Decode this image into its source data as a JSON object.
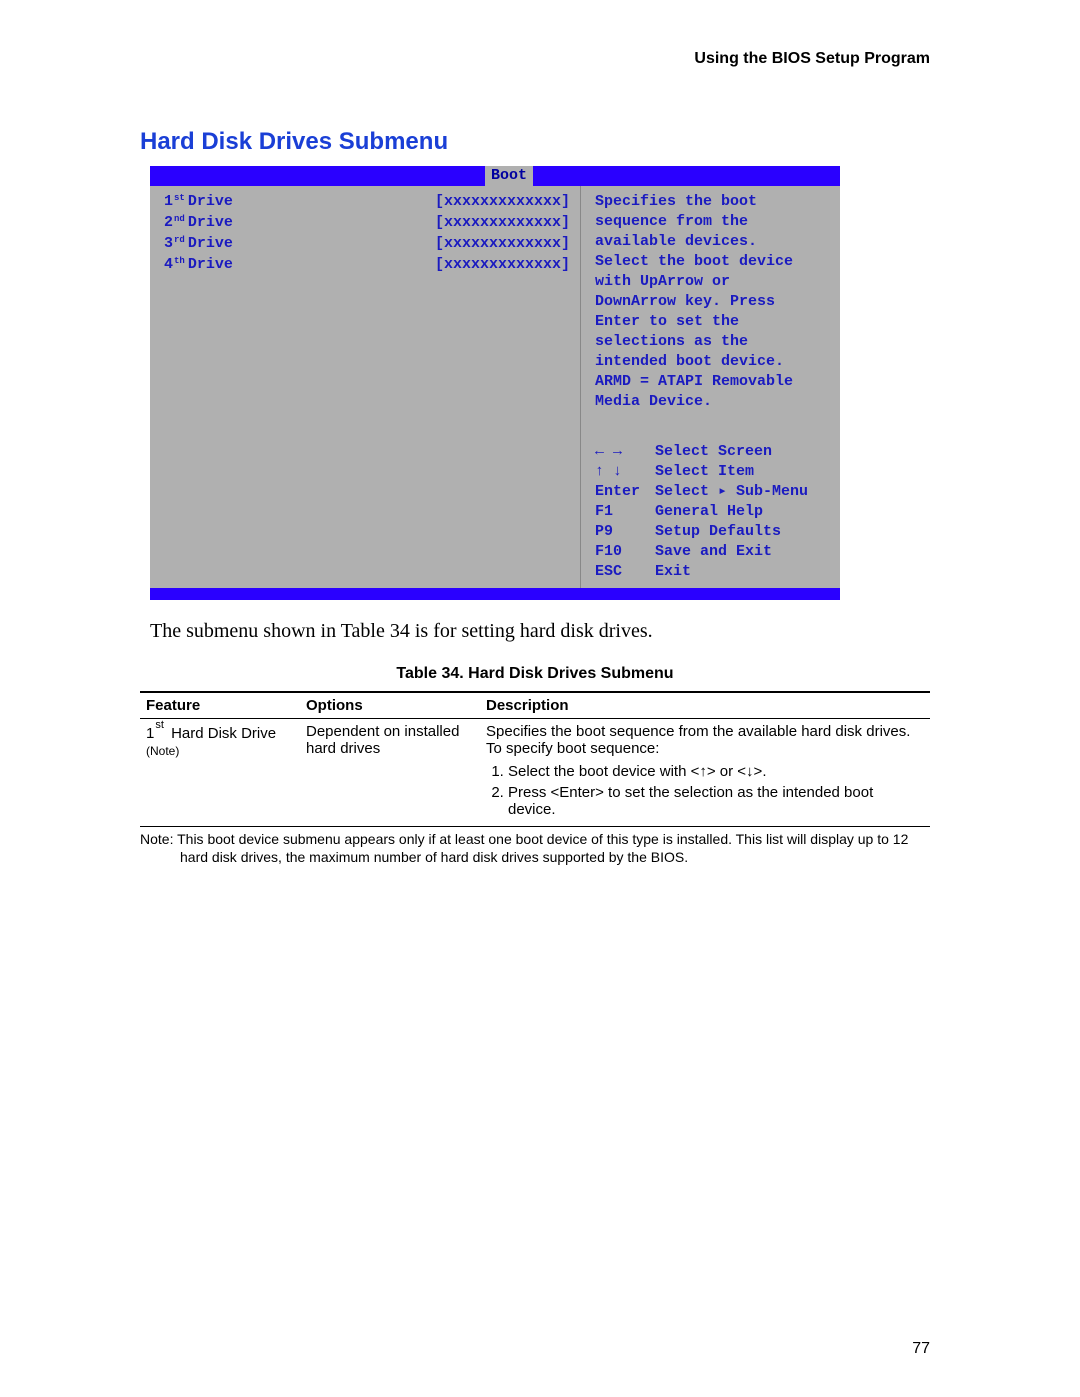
{
  "running_head": "Using the BIOS Setup Program",
  "section_title": "Hard Disk Drives Submenu",
  "bios": {
    "tab_label": "Boot",
    "drives": [
      {
        "num": "1",
        "ord": "st",
        "label": "Drive",
        "value": "[xxxxxxxxxxxxx]"
      },
      {
        "num": "2",
        "ord": "nd",
        "label": "Drive",
        "value": "[xxxxxxxxxxxxx]"
      },
      {
        "num": "3",
        "ord": "rd",
        "label": "Drive",
        "value": "[xxxxxxxxxxxxx]"
      },
      {
        "num": "4",
        "ord": "th",
        "label": "Drive",
        "value": "[xxxxxxxxxxxxx]"
      }
    ],
    "help_lines": [
      "Specifies the boot",
      "sequence from the",
      "available devices.",
      "Select the boot device",
      "with UpArrow or",
      "DownArrow key.  Press",
      "Enter to set the",
      "selections as the",
      "intended boot device.",
      "ARMD = ATAPI Removable",
      "Media Device."
    ],
    "keymap": [
      {
        "key": "← →",
        "action": "Select Screen"
      },
      {
        "key": "↑ ↓",
        "action": "Select Item"
      },
      {
        "key": "Enter",
        "action": "Select ▸ Sub-Menu"
      },
      {
        "key": "F1",
        "action": "General Help"
      },
      {
        "key": "P9",
        "action": "Setup Defaults"
      },
      {
        "key": "F10",
        "action": "Save and Exit"
      },
      {
        "key": "ESC",
        "action": "Exit"
      }
    ]
  },
  "caption_para": "The submenu shown in Table 34 is for setting hard disk drives.",
  "table_title": "Table 34.    Hard Disk Drives Submenu",
  "table": {
    "headers": {
      "feature": "Feature",
      "options": "Options",
      "description": "Description"
    },
    "row": {
      "feature_num": "1",
      "feature_ord": "st",
      "feature_rest": " Hard Disk Drive",
      "feature_note": "(Note)",
      "options": "Dependent on installed hard drives",
      "desc_intro": "Specifies the boot sequence from the available hard disk drives.  To specify boot sequence:",
      "desc_steps": [
        "Select the boot device with <↑> or <↓>.",
        "Press <Enter> to set the selection as the intended boot device."
      ]
    }
  },
  "table_note_label": "Note:",
  "table_note_text": "This boot device submenu appears only if at least one boot device of this type is installed.  This list will display up to 12 hard disk drives, the maximum number of hard disk drives supported by the BIOS.",
  "page_number": "77"
}
